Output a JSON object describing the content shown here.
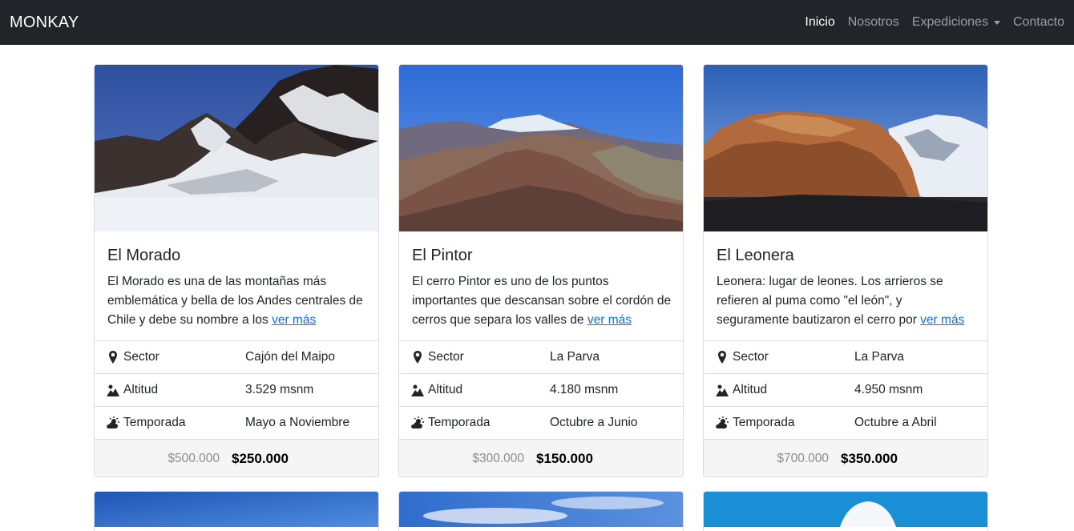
{
  "navbar": {
    "brand": "MONKAY",
    "links": [
      {
        "label": "Inicio",
        "active": true
      },
      {
        "label": "Nosotros",
        "active": false
      },
      {
        "label": "Expediciones",
        "active": false,
        "dropdown": true
      },
      {
        "label": "Contacto",
        "active": false
      }
    ]
  },
  "cards": [
    {
      "title": "El Morado",
      "text": "El Morado es una de las montañas más emblemática y bella de los Andes centrales de Chile y debe su nombre a los",
      "link": "ver más",
      "rows": [
        {
          "icon": "map-marker-icon",
          "label": "Sector",
          "value": "Cajón del Maipo"
        },
        {
          "icon": "mountain-icon",
          "label": "Altitud",
          "value": "3.529 msnm"
        },
        {
          "icon": "sun-cloud-icon",
          "label": "Temporada",
          "value": "Mayo a Noviembre"
        }
      ],
      "old_price": "$500.000",
      "price": "$250.000"
    },
    {
      "title": "El Pintor",
      "text": "El cerro Pintor es uno de los puntos importantes que descansan sobre el cordón de cerros que separa los valles de",
      "link": "ver más",
      "rows": [
        {
          "icon": "map-marker-icon",
          "label": "Sector",
          "value": "La Parva"
        },
        {
          "icon": "mountain-icon",
          "label": "Altitud",
          "value": "4.180 msnm"
        },
        {
          "icon": "sun-cloud-icon",
          "label": "Temporada",
          "value": "Octubre a Junio"
        }
      ],
      "old_price": "$300.000",
      "price": "$150.000"
    },
    {
      "title": "El Leonera",
      "text": "Leonera: lugar de leones. Los arrieros se refieren al puma como \"el león\", y seguramente bautizaron el cerro por",
      "link": "ver más",
      "rows": [
        {
          "icon": "map-marker-icon",
          "label": "Sector",
          "value": "La Parva"
        },
        {
          "icon": "mountain-icon",
          "label": "Altitud",
          "value": "4.950 msnm"
        },
        {
          "icon": "sun-cloud-icon",
          "label": "Temporada",
          "value": "Octubre a Abril"
        }
      ],
      "old_price": "$700.000",
      "price": "$350.000"
    }
  ],
  "colors": {
    "navbar_bg": "#212529",
    "link": "#0d6efd",
    "footer_bg": "#f5f5f5"
  }
}
